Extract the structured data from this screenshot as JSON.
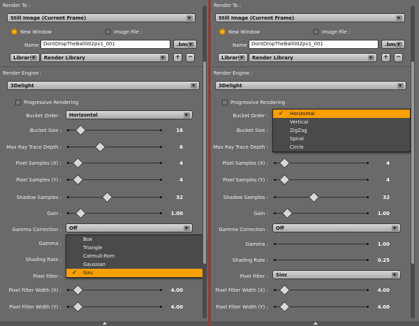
{
  "render_to": {
    "header": "Render To :",
    "selected": "Still Image (Current Frame)",
    "new_window_label": "New Window",
    "image_file_label": "Image File :",
    "name_label": "Name :",
    "name_value": "DontDropTheBall002pv1_001",
    "format": ".bmp",
    "library_label": "Library",
    "render_library_label": "Render Library",
    "plus": "+",
    "minus": "−"
  },
  "render_engine": {
    "header": "Render Engine :",
    "selected": "3Delight"
  },
  "progressive_label": "Progressive Rendering",
  "bucket_order": {
    "label": "Bucket Order :",
    "selected": "Horizontal",
    "options": [
      "Horizontal",
      "Vertical",
      "ZigZag",
      "Spiral",
      "Circle"
    ]
  },
  "sliders": [
    {
      "label": "Bucket Size :",
      "value": "16",
      "pos": 0.13
    },
    {
      "label": "Max Ray Trace Depth :",
      "value": "6",
      "pos": 0.34
    },
    {
      "label": "Pixel Samples (X) :",
      "value": "4",
      "pos": 0.1
    },
    {
      "label": "Pixel Samples (Y) :",
      "value": "4",
      "pos": 0.1
    },
    {
      "label": "Shadow Samples :",
      "value": "32",
      "pos": 0.42
    },
    {
      "label": "Gain :",
      "value": "1.00",
      "pos": 0.13
    }
  ],
  "gamma_correction": {
    "label": "Gamma Correction :",
    "selected": "Off"
  },
  "gamma": {
    "label": "Gamma :",
    "value": "1.00"
  },
  "shading_rate": {
    "label": "Shading Rate :",
    "value": "0.25"
  },
  "pixel_filter": {
    "label": "Pixel Filter :",
    "selected": "Sinc",
    "options": [
      "Box",
      "Triangle",
      "Catmull-Rom",
      "Gaussian",
      "Sinc"
    ]
  },
  "filter_width_x": {
    "label": "Pixel Filter Width (X) :",
    "value": "4.00",
    "pos": 0.1
  },
  "filter_width_y": {
    "label": "Pixel Filter Width (Y) :",
    "value": "4.00",
    "pos": 0.1
  },
  "icons": {
    "check": "✔"
  }
}
